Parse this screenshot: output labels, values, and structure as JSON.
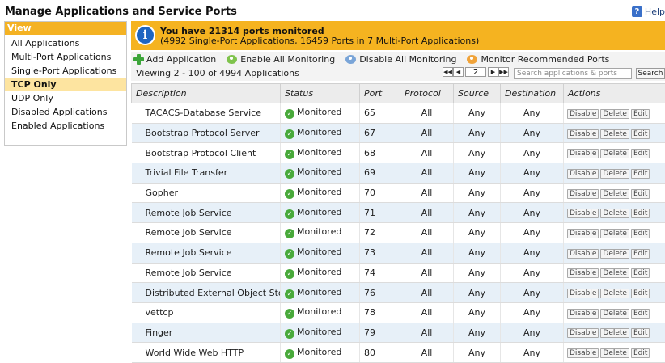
{
  "header": {
    "title": "Manage Applications and Service Ports",
    "help_label": "Help"
  },
  "sidebar": {
    "title": "View",
    "items": [
      {
        "label": "All Applications",
        "active": false
      },
      {
        "label": "Multi-Port Applications",
        "active": false
      },
      {
        "label": "Single-Port Applications",
        "active": false
      },
      {
        "label": "TCP Only",
        "active": true
      },
      {
        "label": "UDP Only",
        "active": false
      },
      {
        "label": "Disabled Applications",
        "active": false
      },
      {
        "label": "Enabled Applications",
        "active": false
      }
    ]
  },
  "banner": {
    "line1": "You have 21314 ports monitored",
    "line2": "(4992 Single-Port Applications, 16459 Ports in 7 Multi-Port Applications)"
  },
  "toolbar": {
    "add": "Add Application",
    "enable_all": "Enable All Monitoring",
    "disable_all": "Disable All Monitoring",
    "monitor_recommended": "Monitor Recommended Ports",
    "viewing": "Viewing 2 - 100 of 4994 Applications",
    "pager": {
      "first": "◀◀",
      "prev": "◀",
      "page": "2",
      "next": "▶",
      "last": "▶▶"
    },
    "search_placeholder": "Search applications & ports",
    "search_button": "Search"
  },
  "table": {
    "columns": [
      "Description",
      "Status",
      "Port",
      "Protocol",
      "Source",
      "Destination",
      "Actions"
    ],
    "actions": [
      "Disable",
      "Delete",
      "Edit"
    ],
    "rows": [
      {
        "description": "TACACS-Database Service",
        "status": "Monitored",
        "port": "65",
        "protocol": "All",
        "source": "Any",
        "destination": "Any"
      },
      {
        "description": "Bootstrap Protocol Server",
        "status": "Monitored",
        "port": "67",
        "protocol": "All",
        "source": "Any",
        "destination": "Any"
      },
      {
        "description": "Bootstrap Protocol Client",
        "status": "Monitored",
        "port": "68",
        "protocol": "All",
        "source": "Any",
        "destination": "Any"
      },
      {
        "description": "Trivial File Transfer",
        "status": "Monitored",
        "port": "69",
        "protocol": "All",
        "source": "Any",
        "destination": "Any"
      },
      {
        "description": "Gopher",
        "status": "Monitored",
        "port": "70",
        "protocol": "All",
        "source": "Any",
        "destination": "Any"
      },
      {
        "description": "Remote Job Service",
        "status": "Monitored",
        "port": "71",
        "protocol": "All",
        "source": "Any",
        "destination": "Any"
      },
      {
        "description": "Remote Job Service",
        "status": "Monitored",
        "port": "72",
        "protocol": "All",
        "source": "Any",
        "destination": "Any"
      },
      {
        "description": "Remote Job Service",
        "status": "Monitored",
        "port": "73",
        "protocol": "All",
        "source": "Any",
        "destination": "Any"
      },
      {
        "description": "Remote Job Service",
        "status": "Monitored",
        "port": "74",
        "protocol": "All",
        "source": "Any",
        "destination": "Any"
      },
      {
        "description": "Distributed External Object Store",
        "status": "Monitored",
        "port": "76",
        "protocol": "All",
        "source": "Any",
        "destination": "Any"
      },
      {
        "description": "vettcp",
        "status": "Monitored",
        "port": "78",
        "protocol": "All",
        "source": "Any",
        "destination": "Any"
      },
      {
        "description": "Finger",
        "status": "Monitored",
        "port": "79",
        "protocol": "All",
        "source": "Any",
        "destination": "Any"
      },
      {
        "description": "World Wide Web HTTP",
        "status": "Monitored",
        "port": "80",
        "protocol": "All",
        "source": "Any",
        "destination": "Any"
      }
    ]
  },
  "icons": {
    "info": "info-icon",
    "help": "help-icon",
    "add": "plus-icon",
    "status": "check-circle-icon"
  }
}
